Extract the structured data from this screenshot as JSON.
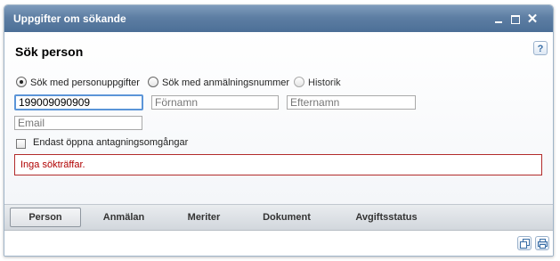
{
  "window": {
    "title": "Uppgifter om sökande",
    "close_glyph": "✕"
  },
  "section": {
    "title": "Sök person",
    "help_label": "?"
  },
  "search_modes": [
    {
      "label": "Sök med personuppgifter",
      "selected": true
    },
    {
      "label": "Sök med anmälningsnummer",
      "selected": false
    },
    {
      "label": "Historik",
      "selected": false
    }
  ],
  "fields": {
    "personnummer": {
      "value": "199009090909",
      "placeholder": ""
    },
    "fornamn": {
      "value": "",
      "placeholder": "Förnamn"
    },
    "efternamn": {
      "value": "",
      "placeholder": "Efternamn"
    },
    "email": {
      "value": "",
      "placeholder": "Email"
    }
  },
  "filter": {
    "label": "Endast öppna antagningsomgångar",
    "checked": false
  },
  "error_message": "Inga sökträffar.",
  "tabs": [
    {
      "label": "Person",
      "active": true
    },
    {
      "label": "Anmälan",
      "active": false
    },
    {
      "label": "Meriter",
      "active": false
    },
    {
      "label": "Dokument",
      "active": false
    },
    {
      "label": "Avgiftsstatus",
      "active": false
    }
  ],
  "footer_icons": [
    "copy-icon",
    "print-icon"
  ],
  "colors": {
    "titlebar": "#5d7ea3",
    "error_border": "#b22b2b",
    "error_text": "#b00000",
    "focus_border": "#5b95d8"
  }
}
